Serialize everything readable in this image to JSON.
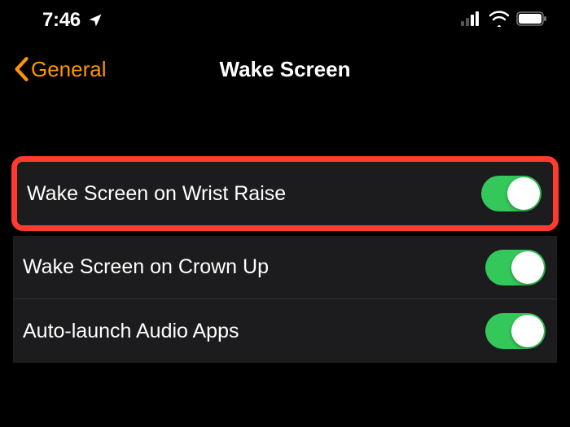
{
  "statusBar": {
    "time": "7:46"
  },
  "nav": {
    "backLabel": "General",
    "title": "Wake Screen"
  },
  "settings": [
    {
      "label": "Wake Screen on Wrist Raise",
      "on": true,
      "highlighted": true
    },
    {
      "label": "Wake Screen on Crown Up",
      "on": true,
      "highlighted": false
    },
    {
      "label": "Auto-launch Audio Apps",
      "on": true,
      "highlighted": false
    }
  ],
  "colors": {
    "accent": "#ff9500",
    "toggleOn": "#34c759",
    "highlight": "#ff3b30"
  }
}
